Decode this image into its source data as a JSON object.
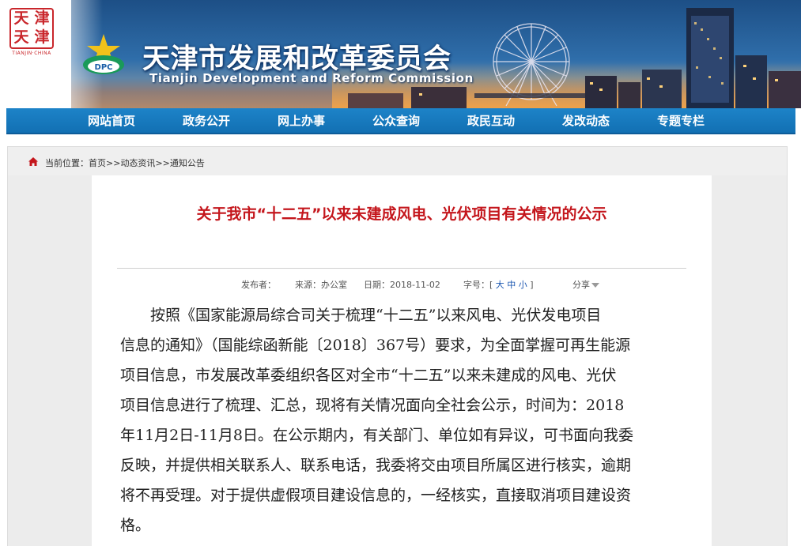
{
  "header": {
    "seal_chars": [
      "天",
      "津",
      "天",
      "津"
    ],
    "seal_caption": "TIANJIN·CHINA",
    "logo_text": "DPC",
    "title": "天津市发展和改革委员会",
    "subtitle": "Tianjin Development and Reform Commission"
  },
  "nav": {
    "items": [
      {
        "label": "网站首页"
      },
      {
        "label": "政务公开"
      },
      {
        "label": "网上办事"
      },
      {
        "label": "公众查询"
      },
      {
        "label": "政民互动"
      },
      {
        "label": "发改动态"
      },
      {
        "label": "专题专栏"
      }
    ]
  },
  "breadcrumb": {
    "prefix": "当前位置：",
    "home": "首页",
    "sep1": ">>",
    "section": "动态资讯",
    "sep2": ">>",
    "current": "通知公告"
  },
  "article": {
    "title": "关于我市“十二五”以来未建成风电、光伏项目有关情况的公示",
    "meta": {
      "publisher_label": "发布者：",
      "source_label": "来源：",
      "source_value": "办公室",
      "date_label": "日期：",
      "date_value": "2018-11-02",
      "fontsize_label": "字号：",
      "fs_open": "[",
      "fs_large": "大",
      "fs_medium": "中",
      "fs_small": "小",
      "fs_close": "]",
      "share_label": "分享"
    },
    "lines": [
      "按照《国家能源局综合司关于梳理“十二五”以来风电、光伏发电项目",
      "信息的通知》（国能综函新能〔2018〕367号）要求，为全面掌握可再生能源",
      "项目信息，市发展改革委组织各区对全市“十二五”以来未建成的风电、光伏",
      "项目信息进行了梳理、汇总，现将有关情况面向全社会公示，时间为：2018",
      "年11月2日-11月8日。在公示期内，有关部门、单位如有异议，可书面向我委",
      "反映，并提供相关联系人、联系电话，我委将交由项目所属区进行核实，逾期",
      "将不再受理。对于提供虚假项目建设信息的，一经核实，直接取消项目建设资",
      "格。"
    ]
  },
  "colors": {
    "nav_bg": "#1a7cc1",
    "title_red": "#c4161c",
    "seal_red": "#c9262b",
    "link_blue": "#1a56b0"
  }
}
